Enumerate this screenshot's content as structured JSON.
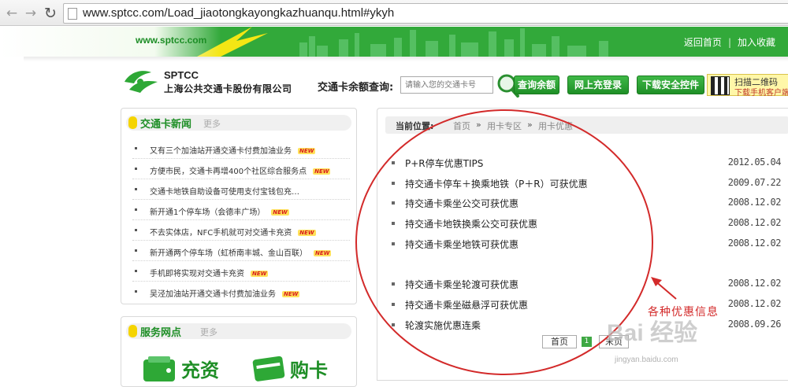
{
  "browser": {
    "url": "www.sptcc.com/Load_jiaotongkayongkazhuanqu.html#ykyh"
  },
  "header": {
    "site_mini": "www.sptcc.com",
    "home_link": "返回首页",
    "sep": "|",
    "favorite_link": "加入收藏",
    "logo_en": "SPTCC",
    "logo_cn": "上海公共交通卡股份有限公司",
    "balance_label": "交通卡余额查询:",
    "card_placeholder": "请输入您的交通卡号",
    "query_button": "查询余额",
    "recharge_button": "网上充登录",
    "download_button": "下载安全控件",
    "qr_text1": "扫描二维码",
    "qr_text2": "下载手机客户端"
  },
  "news": {
    "title": "交通卡新闻",
    "more": "更多",
    "new_badge": "NEW",
    "items": [
      "又有三个加油站开通交通卡付费加油业务",
      "方便市民，交通卡再增400个社区综合服务点",
      "交通卡地铁自助设备可使用支付宝钱包充…",
      "新开通1个停车场（会德丰广场）",
      "不去实体店，NFC手机就可对交通卡充资",
      "新开通两个停车场（虹桥南丰城、金山百联）",
      "手机即将实现对交通卡充资",
      "吴泾加油站开通交通卡付费加油业务"
    ]
  },
  "service": {
    "title": "服务网点",
    "more": "更多",
    "tile1": "充资",
    "tile2": "购卡"
  },
  "breadcrumb": {
    "label": "当前位置:",
    "home": "首页",
    "sep": "»",
    "section": "用卡专区",
    "current": "用卡优惠"
  },
  "offers": [
    {
      "title": "P+R停车优惠TIPS",
      "date": "2012.05.04"
    },
    {
      "title": "持交通卡停车＋换乘地铁（P＋R）可获优惠",
      "date": "2009.07.22"
    },
    {
      "title": "持交通卡乘坐公交可获优惠",
      "date": "2008.12.02"
    },
    {
      "title": "持交通卡地铁换乘公交可获优惠",
      "date": "2008.12.02"
    },
    {
      "title": "持交通卡乘坐地铁可获优惠",
      "date": "2008.12.02"
    },
    {
      "title": "持交通卡乘坐轮渡可获优惠",
      "date": "2008.12.02"
    },
    {
      "title": "持交通卡乘坐磁悬浮可获优惠",
      "date": "2008.12.02"
    },
    {
      "title": "轮渡实施优惠连乘",
      "date": "2008.09.26"
    }
  ],
  "pagination": {
    "first": "首页",
    "current": "1",
    "last": "末页"
  },
  "annotation": {
    "text": "各种优惠信息"
  },
  "watermark": {
    "text": "Bai 经验",
    "url": "jingyan.baidu.com"
  },
  "colors": {
    "brand_green": "#32a93a",
    "title_green": "#1e8e26",
    "annotation_red": "#d32a2a"
  }
}
